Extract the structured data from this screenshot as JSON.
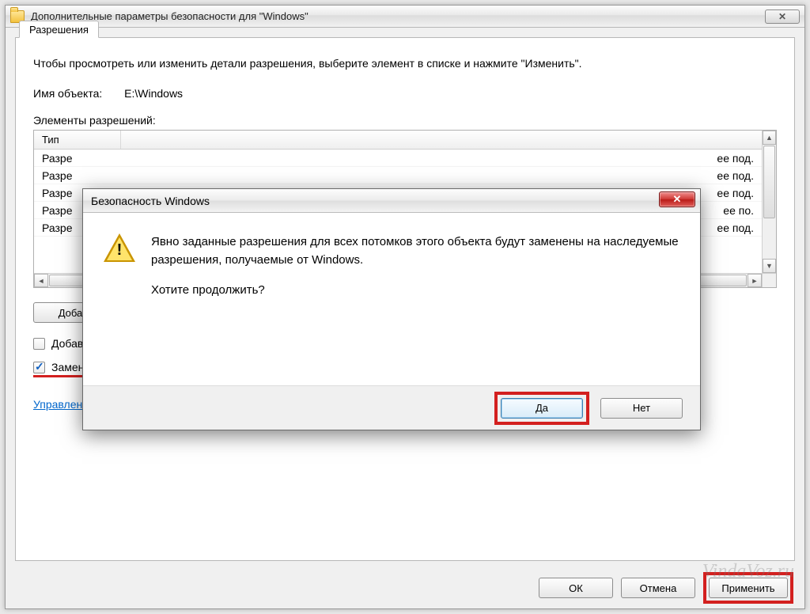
{
  "window": {
    "title": "Дополнительные параметры безопасности  для \"Windows\""
  },
  "tab": {
    "label": "Разрешения"
  },
  "intro": "Чтобы просмотреть или изменить детали разрешения, выберите элемент в списке и нажмите \"Изменить\".",
  "objectNameLabel": "Имя объекта:",
  "objectNameValue": "E:\\Windows",
  "listLabel": "Элементы разрешений:",
  "columns": {
    "type": "Тип"
  },
  "rows": [
    {
      "type": "Разре",
      "tail": "ее под."
    },
    {
      "type": "Разре",
      "tail": "ее под."
    },
    {
      "type": "Разре",
      "tail": "ее под."
    },
    {
      "type": "Разре",
      "tail": "ее по."
    },
    {
      "type": "Разре",
      "tail": "ее под."
    }
  ],
  "buttons": {
    "add": "Доба",
    "ok": "ОК",
    "cancel": "Отмена",
    "apply": "Применить"
  },
  "checkboxes": {
    "inherit": "Добавить разрешения, наследуемые от родительских объектов",
    "replace": "Заменить все разрешения дочернего объекта на разрешения, наследуемые от этого объекта"
  },
  "link": "Управление разрешениями",
  "dialog": {
    "title": "Безопасность Windows",
    "line1": "Явно заданные разрешения для всех потомков этого объекта будут заменены на наследуемые разрешения, получаемые от Windows.",
    "line2": "Хотите продолжить?",
    "yes": "Да",
    "no": "Нет"
  },
  "watermark": "VindaVoz.ru"
}
